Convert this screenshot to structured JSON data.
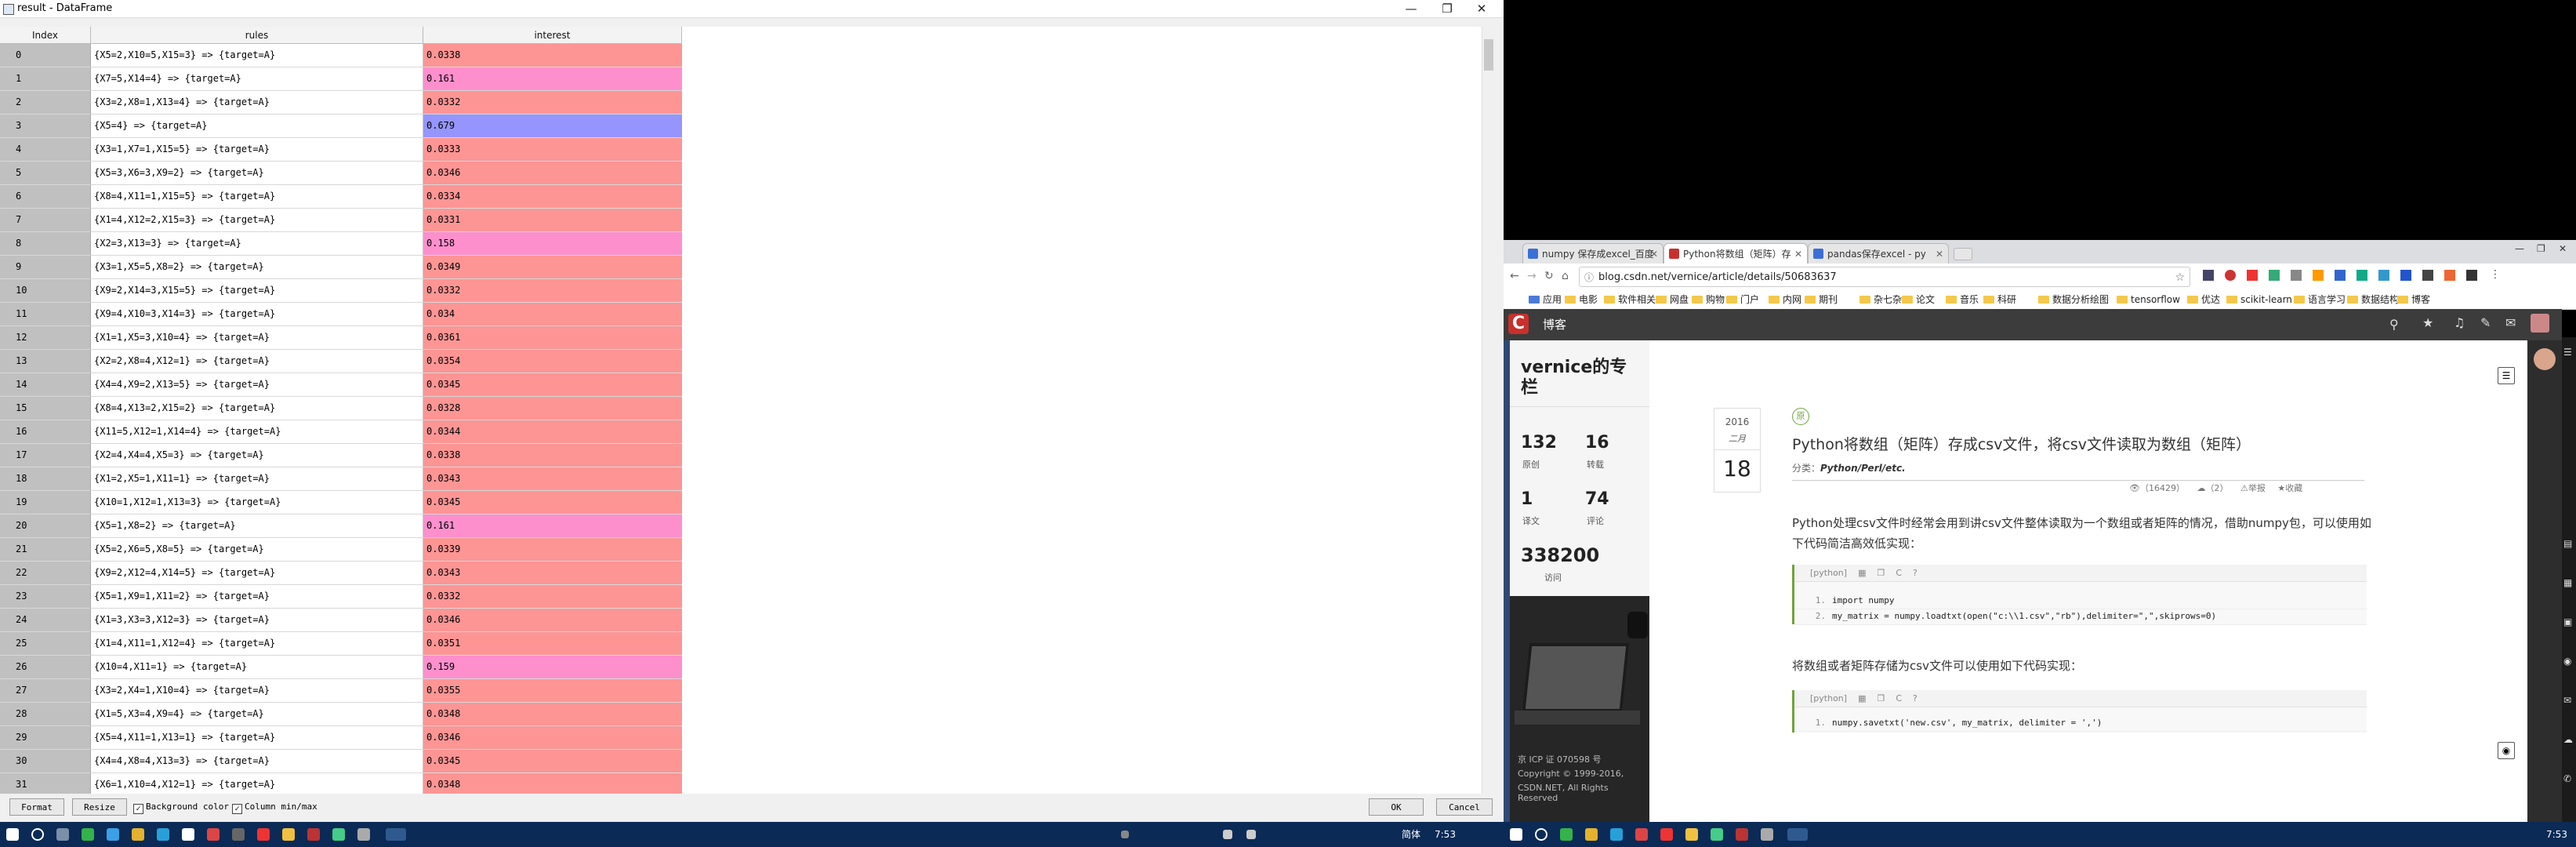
{
  "dataframe_window": {
    "title": "result - DataFrame",
    "columns": {
      "index": "Index",
      "rules": "rules",
      "interest": "interest"
    },
    "rows": [
      {
        "i": "0",
        "rule": "{X5=2,X10=5,X15=3} => {target=A}",
        "v": "0.0338",
        "color": "#fd9595"
      },
      {
        "i": "1",
        "rule": "{X7=5,X14=4} => {target=A}",
        "v": "0.161",
        "color": "#fd8fcd"
      },
      {
        "i": "2",
        "rule": "{X3=2,X8=1,X13=4} => {target=A}",
        "v": "0.0332",
        "color": "#fd9595"
      },
      {
        "i": "3",
        "rule": "{X5=4} => {target=A}",
        "v": "0.679",
        "color": "#9595fd"
      },
      {
        "i": "4",
        "rule": "{X3=1,X7=1,X15=5} => {target=A}",
        "v": "0.0333",
        "color": "#fd9595"
      },
      {
        "i": "5",
        "rule": "{X5=3,X6=3,X9=2} => {target=A}",
        "v": "0.0346",
        "color": "#fd9595"
      },
      {
        "i": "6",
        "rule": "{X8=4,X11=1,X15=5} => {target=A}",
        "v": "0.0334",
        "color": "#fd9595"
      },
      {
        "i": "7",
        "rule": "{X1=4,X12=2,X15=3} => {target=A}",
        "v": "0.0331",
        "color": "#fd9595"
      },
      {
        "i": "8",
        "rule": "{X2=3,X13=3} => {target=A}",
        "v": "0.158",
        "color": "#fd8fcd"
      },
      {
        "i": "9",
        "rule": "{X3=1,X5=5,X8=2} => {target=A}",
        "v": "0.0349",
        "color": "#fd9595"
      },
      {
        "i": "10",
        "rule": "{X9=2,X14=3,X15=5} => {target=A}",
        "v": "0.0332",
        "color": "#fd9595"
      },
      {
        "i": "11",
        "rule": "{X9=4,X10=3,X14=3} => {target=A}",
        "v": "0.034",
        "color": "#fd9595"
      },
      {
        "i": "12",
        "rule": "{X1=1,X5=3,X10=4} => {target=A}",
        "v": "0.0361",
        "color": "#fd9595"
      },
      {
        "i": "13",
        "rule": "{X2=2,X8=4,X12=1} => {target=A}",
        "v": "0.0354",
        "color": "#fd9595"
      },
      {
        "i": "14",
        "rule": "{X4=4,X9=2,X13=5} => {target=A}",
        "v": "0.0345",
        "color": "#fd9595"
      },
      {
        "i": "15",
        "rule": "{X8=4,X13=2,X15=2} => {target=A}",
        "v": "0.0328",
        "color": "#fd9595"
      },
      {
        "i": "16",
        "rule": "{X11=5,X12=1,X14=4} => {target=A}",
        "v": "0.0344",
        "color": "#fd9595"
      },
      {
        "i": "17",
        "rule": "{X2=4,X4=4,X5=3} => {target=A}",
        "v": "0.0338",
        "color": "#fd9595"
      },
      {
        "i": "18",
        "rule": "{X1=2,X5=1,X11=1} => {target=A}",
        "v": "0.0343",
        "color": "#fd9595"
      },
      {
        "i": "19",
        "rule": "{X10=1,X12=1,X13=3} => {target=A}",
        "v": "0.0345",
        "color": "#fd9595"
      },
      {
        "i": "20",
        "rule": "{X5=1,X8=2} => {target=A}",
        "v": "0.161",
        "color": "#fd8fcd"
      },
      {
        "i": "21",
        "rule": "{X5=2,X6=5,X8=5} => {target=A}",
        "v": "0.0339",
        "color": "#fd9595"
      },
      {
        "i": "22",
        "rule": "{X9=2,X12=4,X14=5} => {target=A}",
        "v": "0.0343",
        "color": "#fd9595"
      },
      {
        "i": "23",
        "rule": "{X5=1,X9=1,X11=2} => {target=A}",
        "v": "0.0332",
        "color": "#fd9595"
      },
      {
        "i": "24",
        "rule": "{X1=3,X3=3,X12=3} => {target=A}",
        "v": "0.0346",
        "color": "#fd9595"
      },
      {
        "i": "25",
        "rule": "{X1=4,X11=1,X12=4} => {target=A}",
        "v": "0.0351",
        "color": "#fd9595"
      },
      {
        "i": "26",
        "rule": "{X10=4,X11=1} => {target=A}",
        "v": "0.159",
        "color": "#fd8fcd"
      },
      {
        "i": "27",
        "rule": "{X3=2,X4=1,X10=4} => {target=A}",
        "v": "0.0355",
        "color": "#fd9595"
      },
      {
        "i": "28",
        "rule": "{X1=5,X3=4,X9=4} => {target=A}",
        "v": "0.0348",
        "color": "#fd9595"
      },
      {
        "i": "29",
        "rule": "{X5=4,X11=1,X13=1} => {target=A}",
        "v": "0.0346",
        "color": "#fd9595"
      },
      {
        "i": "30",
        "rule": "{X4=4,X8=4,X13=3} => {target=A}",
        "v": "0.0345",
        "color": "#fd9595"
      },
      {
        "i": "31",
        "rule": "{X6=1,X10=4,X12=1} => {target=A}",
        "v": "0.0348",
        "color": "#fd9595"
      }
    ],
    "buttons": {
      "format": "Format",
      "resize": "Resize",
      "ok": "OK",
      "cancel": "Cancel"
    },
    "checkboxes": {
      "background_color": "Background color",
      "column_minmax": "Column min/max"
    }
  },
  "taskbar_left": {
    "lang": "简体",
    "time": "7:53"
  },
  "taskbar_right": {
    "time": "7:53"
  },
  "browser": {
    "tabs": [
      {
        "label": "numpy 保存成excel_百度",
        "color": "#3b6fd8"
      },
      {
        "label": "Python将数组（矩阵）存",
        "color": "#c9302c"
      },
      {
        "label": "pandas保存excel - py",
        "color": "#3b6fd8"
      }
    ],
    "url": "blog.csdn.net/vernice/article/details/50683637",
    "bookmarks": [
      "应用",
      "电影",
      "软件相关",
      "网盘",
      "购物",
      "门户",
      "内网",
      "期刊",
      "杂七杂八",
      "论文",
      "音乐",
      "科研",
      "数据分析绘图",
      "tensorflow",
      "优达",
      "scikit-learn",
      "语言学习",
      "数据结构",
      "博客"
    ],
    "nav_title": "博客"
  },
  "blog": {
    "blog_name": "vernice的专栏",
    "stats": [
      {
        "num": "132",
        "label": "原创"
      },
      {
        "num": "16",
        "label": "转载"
      },
      {
        "num": "1",
        "label": "译文"
      },
      {
        "num": "74",
        "label": "评论"
      }
    ],
    "visits": {
      "num": "338200",
      "label": "访问"
    },
    "footer": [
      "京 ICP 证 070598 号",
      "Copyright © 1999-2016,",
      "CSDN.NET, All Rights Reserved"
    ],
    "date": {
      "year": "2016",
      "month": "二月",
      "day": "18"
    },
    "badge": "原",
    "title": "Python将数组（矩阵）存成csv文件，将csv文件读取为数组（矩阵）",
    "category_label": "分类：",
    "category": "Python/Perl/etc.",
    "meta": {
      "views": "（16429）",
      "comments": "（2）",
      "report": "举报",
      "favorite": "收藏"
    },
    "para1": "Python处理csv文件时经常会用到讲csv文件整体读取为一个数组或者矩阵的情况，借助numpy包，可以使用如下代码简洁高效低实现：",
    "code1": {
      "lang": "[python]",
      "lines": [
        {
          "n": "1.",
          "t": "import numpy"
        },
        {
          "n": "2.",
          "t": "my_matrix = numpy.loadtxt(open(\"c:\\\\1.csv\",\"rb\"),delimiter=\",\",skiprows=0)"
        }
      ]
    },
    "para2": "将数组或者矩阵存储为csv文件可以使用如下代码实现：",
    "code2": {
      "lang": "[python]",
      "lines": [
        {
          "n": "1.",
          "t": "numpy.savetxt('new.csv', my_matrix, delimiter = ',')"
        }
      ]
    }
  }
}
